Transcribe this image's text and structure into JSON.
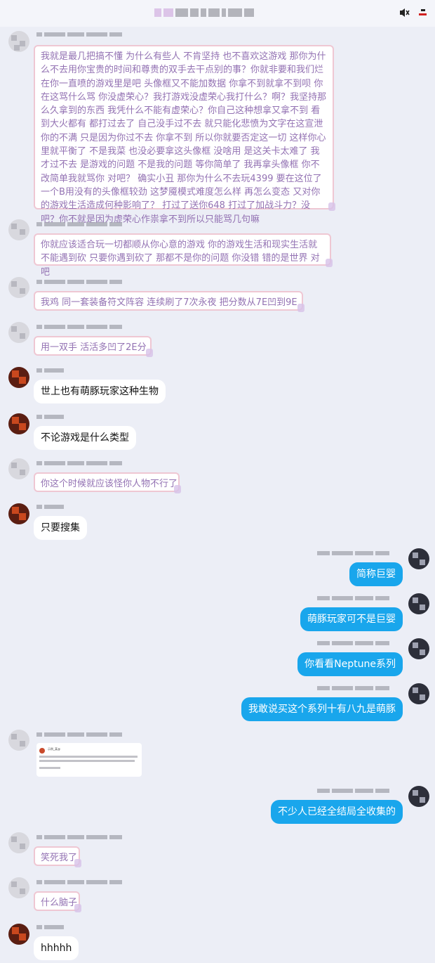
{
  "header": {
    "title": "",
    "icons": [
      "mute-icon",
      "minimize-icon"
    ]
  },
  "messages": [
    {
      "side": "left",
      "style": "pink",
      "text": "我就是最几把搞不懂 为什么有些人 不肯坚持 也不喜欢这游戏 那你为什么不去用你宝贵的时间和尊贵的双手去干点别的事？你就非要和我们烂在你一直喷的游戏里是吧 头像框又不能加数据 你拿不到就拿不到呗 你在这骂什么骂 你没虚荣心？我打游戏没虚荣心我打什么？啊？我坚持那么久拿到的东西 我凭什么不能有虚荣心？你自己这种想拿又拿不到 看到大火都有 都打过去了 自己没手过不去 就只能化悲愤为文字在这宣泄你的不满 只是因为你过不去 你拿不到 所以你就要否定这一切 这样你心里就平衡了 不是我菜 也没必要拿这头像框 没啥用 是这关卡太难了 我才过不去 是游戏的问题 不是我的问题 等你简单了 我再拿头像框 你不改简单我就骂你 对吧？ 确实小丑 那你为什么不去玩4399 要在这位了一个B用没有的头像框较劲 这梦魇模式难度怎么样 再怎么变态 又对你的游戏生活造成何种影响了？ 打过了送你648 打过了加战斗力？没吧？你不就是因为虚荣心作祟拿不到所以只能骂几句嘛"
    },
    {
      "side": "left",
      "style": "pink",
      "text": "你就应该适合玩一切都顺从你心意的游戏 你的游戏生活和现实生活就不能遇到砍 只要你遇到砍了 那都不是你的问题 你没错 错的是世界 对吧"
    },
    {
      "side": "left",
      "style": "pink",
      "text": "我鸡 同一套装备符文阵容 连续刷了7次永夜 把分数从7E凹到9E"
    },
    {
      "side": "left",
      "style": "pink",
      "text": "用一双手 活活多凹了2E分"
    },
    {
      "side": "left",
      "style": "white",
      "text": "世上也有萌豚玩家这种生物"
    },
    {
      "side": "left",
      "style": "white",
      "text": "不论游戏是什么类型"
    },
    {
      "side": "left",
      "style": "pink",
      "text": "你这个时候就应该怪你人物不行了"
    },
    {
      "side": "left",
      "style": "white",
      "text": "只要搜集"
    },
    {
      "side": "right",
      "style": "blue",
      "text": "简称巨婴"
    },
    {
      "side": "right",
      "style": "blue",
      "text": "萌豚玩家可不是巨婴"
    },
    {
      "side": "right",
      "style": "blue",
      "text": "你看看Neptune系列"
    },
    {
      "side": "right",
      "style": "blue",
      "text": "我敢说买这个系列十有八九是萌豚"
    },
    {
      "side": "left",
      "style": "card",
      "text": ""
    },
    {
      "side": "right",
      "style": "blue",
      "text": "不少人已经全结局全收集的"
    },
    {
      "side": "left",
      "style": "pink",
      "text": "笑死我了"
    },
    {
      "side": "left",
      "style": "pink",
      "text": "什么脑子"
    },
    {
      "side": "left",
      "style": "white",
      "text": "hhhhh"
    }
  ],
  "shared_card": {
    "name": "示例_某@"
  },
  "colors": {
    "background": "#eceef6",
    "pink_text": "#9372b3",
    "pink_border": "#efc7d3",
    "blue_bubble": "#19a6ec"
  }
}
